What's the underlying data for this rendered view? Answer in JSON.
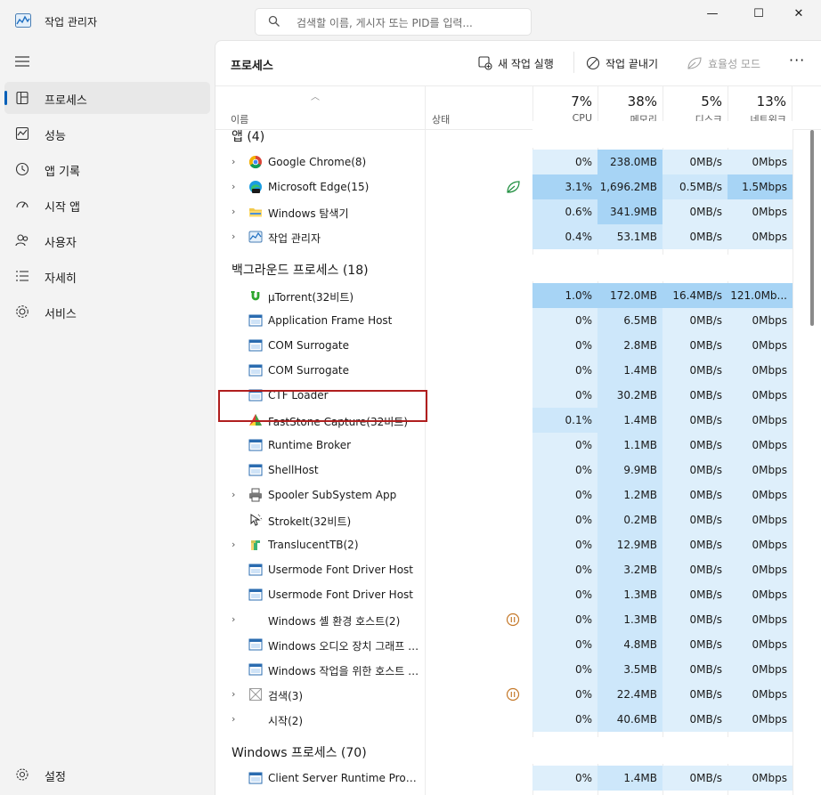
{
  "window": {
    "title": "작업 관리자",
    "minimize_glyph": "—",
    "maximize_glyph": "☐",
    "close_glyph": "✕"
  },
  "search": {
    "placeholder": "검색할 이름, 게시자 또는 PID를 입력..."
  },
  "sidebar": {
    "items": [
      {
        "label": "프로세스",
        "icon": "processes-icon",
        "active": true
      },
      {
        "label": "성능",
        "icon": "performance-icon"
      },
      {
        "label": "앱 기록",
        "icon": "app-history-icon"
      },
      {
        "label": "시작 앱",
        "icon": "startup-icon"
      },
      {
        "label": "사용자",
        "icon": "users-icon"
      },
      {
        "label": "자세히",
        "icon": "details-icon"
      },
      {
        "label": "서비스",
        "icon": "services-icon"
      }
    ],
    "settings": {
      "label": "설정",
      "icon": "settings-icon"
    }
  },
  "toolbar": {
    "title": "프로세스",
    "new_task": "새 작업 실행",
    "end_task": "작업 끝내기",
    "efficiency_mode": "효율성 모드",
    "more": "···"
  },
  "columns": {
    "name": "이름",
    "status": "상태",
    "cpu": {
      "pct": "7%",
      "label": "CPU"
    },
    "memory": {
      "pct": "38%",
      "label": "메모리"
    },
    "disk": {
      "pct": "5%",
      "label": "디스크"
    },
    "network": {
      "pct": "13%",
      "label": "네트워크"
    }
  },
  "groups": {
    "apps": "앱 (4)",
    "background": "백그라운드 프로세스 (18)",
    "windows": "Windows 프로세스 (70)"
  },
  "rows": [
    {
      "name": "Google Chrome(8)",
      "cpu": "0%",
      "mem": "238.0MB",
      "disk": "0MB/s",
      "net": "0Mbps",
      "icon": "chrome-icon"
    },
    {
      "name": "Microsoft Edge(15)",
      "cpu": "3.1%",
      "mem": "1,696.2MB",
      "disk": "0.5MB/s",
      "net": "1.5Mbps",
      "icon": "edge-icon",
      "status_icon": "efficiency-leaf-icon"
    },
    {
      "name": "Windows 탐색기",
      "cpu": "0.6%",
      "mem": "341.9MB",
      "disk": "0MB/s",
      "net": "0Mbps",
      "icon": "folder-icon"
    },
    {
      "name": "작업 관리자",
      "cpu": "0.4%",
      "mem": "53.1MB",
      "disk": "0MB/s",
      "net": "0Mbps",
      "icon": "task-manager-icon"
    },
    {
      "name": "µTorrent(32비트)",
      "cpu": "1.0%",
      "mem": "172.0MB",
      "disk": "16.4MB/s",
      "net": "121.0Mb...",
      "icon": "utorrent-icon"
    },
    {
      "name": "Application Frame Host",
      "cpu": "0%",
      "mem": "6.5MB",
      "disk": "0MB/s",
      "net": "0Mbps",
      "icon": "window-app-icon"
    },
    {
      "name": "COM Surrogate",
      "cpu": "0%",
      "mem": "2.8MB",
      "disk": "0MB/s",
      "net": "0Mbps",
      "icon": "window-app-icon"
    },
    {
      "name": "COM Surrogate",
      "cpu": "0%",
      "mem": "1.4MB",
      "disk": "0MB/s",
      "net": "0Mbps",
      "icon": "window-app-icon"
    },
    {
      "name": "CTF Loader",
      "cpu": "0%",
      "mem": "30.2MB",
      "disk": "0MB/s",
      "net": "0Mbps",
      "icon": "window-app-icon"
    },
    {
      "name": "FastStone Capture(32비트)",
      "cpu": "0.1%",
      "mem": "1.4MB",
      "disk": "0MB/s",
      "net": "0Mbps",
      "icon": "faststone-icon"
    },
    {
      "name": "Runtime Broker",
      "cpu": "0%",
      "mem": "1.1MB",
      "disk": "0MB/s",
      "net": "0Mbps",
      "icon": "window-app-icon"
    },
    {
      "name": "ShellHost",
      "cpu": "0%",
      "mem": "9.9MB",
      "disk": "0MB/s",
      "net": "0Mbps",
      "icon": "window-app-icon"
    },
    {
      "name": "Spooler SubSystem App",
      "cpu": "0%",
      "mem": "1.2MB",
      "disk": "0MB/s",
      "net": "0Mbps",
      "icon": "printer-icon"
    },
    {
      "name": "StrokeIt(32비트)",
      "cpu": "0%",
      "mem": "0.2MB",
      "disk": "0MB/s",
      "net": "0Mbps",
      "icon": "strokeit-icon"
    },
    {
      "name": "TranslucentTB(2)",
      "cpu": "0%",
      "mem": "12.9MB",
      "disk": "0MB/s",
      "net": "0Mbps",
      "icon": "translucenttb-icon"
    },
    {
      "name": "Usermode Font Driver Host",
      "cpu": "0%",
      "mem": "3.2MB",
      "disk": "0MB/s",
      "net": "0Mbps",
      "icon": "window-app-icon"
    },
    {
      "name": "Usermode Font Driver Host",
      "cpu": "0%",
      "mem": "1.3MB",
      "disk": "0MB/s",
      "net": "0Mbps",
      "icon": "window-app-icon"
    },
    {
      "name": "Windows 셸 환경 호스트(2)",
      "cpu": "0%",
      "mem": "1.3MB",
      "disk": "0MB/s",
      "net": "0Mbps",
      "icon": "",
      "status_icon": "suspended-icon"
    },
    {
      "name": "Windows 오디오 장치 그래프 격리",
      "cpu": "0%",
      "mem": "4.8MB",
      "disk": "0MB/s",
      "net": "0Mbps",
      "icon": "window-app-icon"
    },
    {
      "name": "Windows 작업을 위한 호스트 프로세스",
      "cpu": "0%",
      "mem": "3.5MB",
      "disk": "0MB/s",
      "net": "0Mbps",
      "icon": "window-app-icon"
    },
    {
      "name": "검색(3)",
      "cpu": "0%",
      "mem": "22.4MB",
      "disk": "0MB/s",
      "net": "0Mbps",
      "icon": "search-app-icon",
      "status_icon": "suspended-icon"
    },
    {
      "name": "시작(2)",
      "cpu": "0%",
      "mem": "40.6MB",
      "disk": "0MB/s",
      "net": "0Mbps",
      "icon": ""
    },
    {
      "name": "Client Server Runtime Process",
      "cpu": "0%",
      "mem": "1.4MB",
      "disk": "0MB/s",
      "net": "0Mbps",
      "icon": "window-app-icon"
    }
  ]
}
